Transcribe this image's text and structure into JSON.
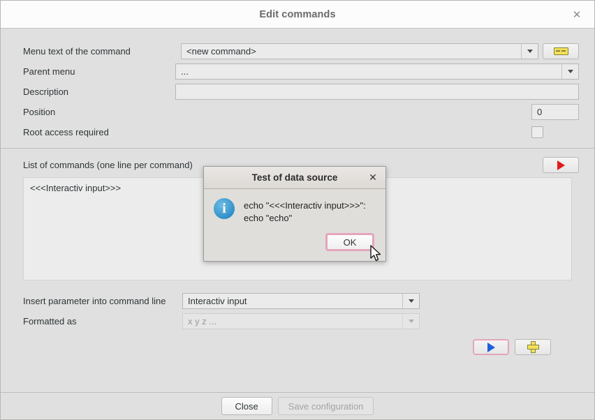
{
  "window": {
    "title": "Edit commands",
    "close_icon": "close-icon"
  },
  "form": {
    "rows": [
      {
        "label": "Menu text of the command",
        "value": "<new command>"
      },
      {
        "label": "Parent menu",
        "value": "..."
      },
      {
        "label": "Description",
        "value": ""
      },
      {
        "label": "Position",
        "value": "0"
      },
      {
        "label": "Root access required",
        "value": ""
      }
    ],
    "menu_text_label": "Menu text of the command",
    "menu_text_value": "<new command>",
    "parent_menu_label": "Parent menu",
    "parent_menu_value": "...",
    "description_label": "Description",
    "description_value": "",
    "position_label": "Position",
    "position_value": "0",
    "root_access_label": "Root access required",
    "root_access_checked": false,
    "tag_button_icon": "tag-icon"
  },
  "commands": {
    "label": "List of commands (one line per command)",
    "run_button_icon": "play-icon-red",
    "text": "<<<Interactiv input>>>"
  },
  "parameters": {
    "insert_label": "Insert parameter into command line",
    "insert_value": "Interactiv input",
    "formatted_label": "Formatted as",
    "formatted_value": "x y z ...",
    "test_button_icon": "play-icon-blue",
    "add_button_icon": "plus-icon"
  },
  "footer": {
    "close_label": "Close",
    "save_label": "Save configuration",
    "save_disabled": true
  },
  "modal": {
    "title": "Test of data source",
    "close_icon": "close-icon",
    "info_icon": "info-icon",
    "info_glyph": "i",
    "message": "echo \"<<<Interactiv input>>>\":\necho \"echo\"",
    "ok_label": "OK"
  },
  "colors": {
    "accent_red": "#e01b1b",
    "accent_blue": "#1e5fd8",
    "accent_yellow": "#f2e05a",
    "focus_pink": "#e4a5bd",
    "window_bg": "#e0e0e0"
  }
}
